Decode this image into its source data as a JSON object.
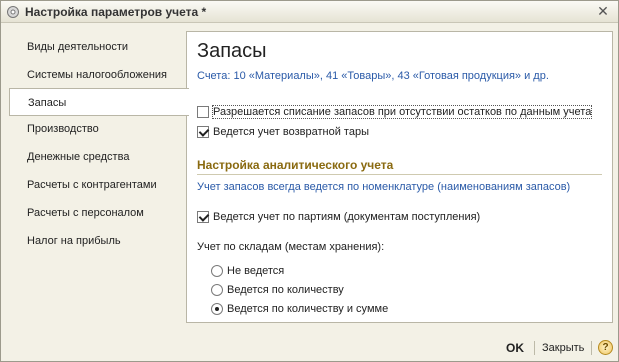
{
  "window": {
    "title": "Настройка параметров учета *"
  },
  "sidebar": {
    "items": [
      {
        "label": "Виды деятельности"
      },
      {
        "label": "Системы налогообложения"
      },
      {
        "label": "Запасы"
      },
      {
        "label": "Производство"
      },
      {
        "label": "Денежные средства"
      },
      {
        "label": "Расчеты с контрагентами"
      },
      {
        "label": "Расчеты с персоналом"
      },
      {
        "label": "Налог на прибыль"
      }
    ],
    "active_index": 2
  },
  "main": {
    "heading": "Запасы",
    "accounts_text": "Счета: 10 «Материалы», 41 «Товары», 43 «Готовая продукция» и др.",
    "options": [
      {
        "label": "Разрешается списание запасов при отсутствии остатков по данным учета",
        "checked": false
      },
      {
        "label": "Ведется учет возвратной тары",
        "checked": true
      }
    ],
    "analytics": {
      "title": "Настройка аналитического учета",
      "info": "Учет запасов всегда ведется по номенклатуре (наименованиям запасов)",
      "batch_label": "Ведется учет по партиям (документам поступления)",
      "batch_checked": true,
      "warehouse_label": "Учет по складам (местам хранения):",
      "warehouse_options": [
        {
          "label": "Не ведется",
          "selected": false
        },
        {
          "label": "Ведется по количеству",
          "selected": false
        },
        {
          "label": "Ведется по количеству и сумме",
          "selected": true
        }
      ]
    }
  },
  "footer": {
    "ok_label": "OK",
    "close_label": "Закрыть",
    "help_label": "?"
  },
  "colors": {
    "accent_link": "#2a5aa8",
    "section_title": "#8a6a10"
  }
}
